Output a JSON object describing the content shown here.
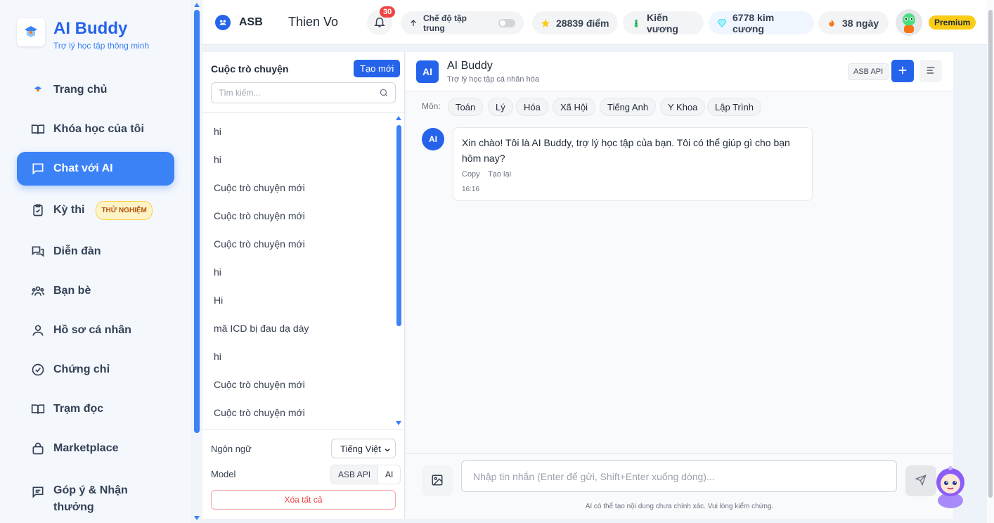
{
  "brand": {
    "title": "AI Buddy",
    "subtitle": "Trợ lý học tập thông minh"
  },
  "sidebar": {
    "items": [
      {
        "label": "Trang chủ",
        "icon": "home-logo-icon"
      },
      {
        "label": "Khóa học của tôi",
        "icon": "book-open-icon"
      },
      {
        "label": "Chat với AI",
        "icon": "chat-icon",
        "active": true
      },
      {
        "label": "Kỳ thi",
        "icon": "clipboard-check-icon",
        "badge": "THỬ NGHIỆM"
      },
      {
        "label": "Diễn đàn",
        "icon": "forum-icon"
      },
      {
        "label": "Bạn bè",
        "icon": "users-icon"
      },
      {
        "label": "Hồ sơ cá nhân",
        "icon": "user-icon"
      },
      {
        "label": "Chứng chỉ",
        "icon": "certificate-icon"
      },
      {
        "label": "Trạm đọc",
        "icon": "book-icon"
      },
      {
        "label": "Marketplace",
        "icon": "bag-icon"
      },
      {
        "label": "Góp ý & Nhận thưởng",
        "icon": "feedback-icon"
      }
    ]
  },
  "header": {
    "org": "ASB",
    "username": "Thien Vo",
    "notifications": "30",
    "focus_mode": "Chế độ tập trung",
    "points": "28839 điểm",
    "rank": "Kiến vương",
    "gems": "6778 kim cương",
    "streak": "38 ngày",
    "plan": "Premium"
  },
  "conversations": {
    "heading": "Cuộc trò chuyện",
    "new_label": "Tạo mới",
    "search_placeholder": "Tìm kiếm...",
    "items": [
      "hi",
      "hi",
      "Cuộc trò chuyện mới",
      "Cuộc trò chuyện mới",
      "Cuộc trò chuyện mới",
      "hi",
      "Hi",
      "mã ICD bị đau dạ dày",
      "hi",
      "Cuộc trò chuyện mới",
      "Cuộc trò chuyện mới"
    ],
    "language_label": "Ngôn ngữ",
    "language_value": "Tiếng Việt",
    "model_label": "Model",
    "model_options": [
      "ASB API",
      "AI"
    ],
    "clear_label": "Xóa tất cả"
  },
  "chat": {
    "logo": "AI",
    "title": "AI Buddy",
    "subtitle": "Trợ lý học tập cá nhân hóa",
    "api_badge": "ASB API",
    "subject_label": "Môn:",
    "subjects": [
      "Toán",
      "Lý",
      "Hóa",
      "Xã Hội",
      "Tiếng Anh",
      "Y Khoa",
      "Lập Trình"
    ],
    "messages": [
      {
        "avatar": "AI",
        "text": "Xin chào! Tôi là AI Buddy, trợ lý học tập của bạn. Tôi có thể giúp gì cho bạn hôm nay?",
        "copy": "Copy",
        "regenerate": "Tạo lại",
        "time": "16:16"
      }
    ],
    "input_placeholder": "Nhập tin nhắn (Enter để gửi, Shift+Enter xuống dòng)...",
    "disclaimer": "AI có thể tạo nội dung chưa chính xác. Vui lòng kiểm chứng."
  },
  "colors": {
    "accent": "#2563eb",
    "accent_light": "#3b82f6",
    "premium": "#facc15",
    "danger": "#ef4444"
  }
}
